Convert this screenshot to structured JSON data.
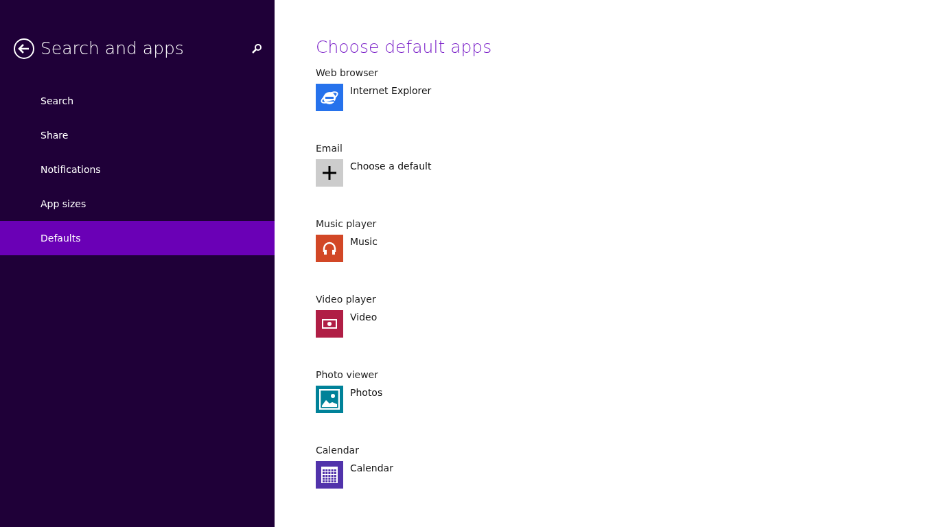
{
  "sidebar": {
    "title": "Search and apps",
    "items": [
      {
        "label": "Search",
        "selected": false
      },
      {
        "label": "Share",
        "selected": false
      },
      {
        "label": "Notifications",
        "selected": false
      },
      {
        "label": "App sizes",
        "selected": false
      },
      {
        "label": "Defaults",
        "selected": true
      }
    ]
  },
  "content": {
    "heading": "Choose default apps",
    "defaults": [
      {
        "category": "Web browser",
        "app": "Internet Explorer",
        "kind": "browser",
        "color": "#2672ec"
      },
      {
        "category": "Email",
        "app": "Choose a default",
        "kind": "add",
        "color": "#cccccc"
      },
      {
        "category": "Music player",
        "app": "Music",
        "kind": "music",
        "color": "#d24726"
      },
      {
        "category": "Video player",
        "app": "Video",
        "kind": "video",
        "color": "#b01e45"
      },
      {
        "category": "Photo viewer",
        "app": "Photos",
        "kind": "photos",
        "color": "#008299"
      },
      {
        "category": "Calendar",
        "app": "Calendar",
        "kind": "calendar",
        "color": "#5133ab"
      }
    ]
  }
}
